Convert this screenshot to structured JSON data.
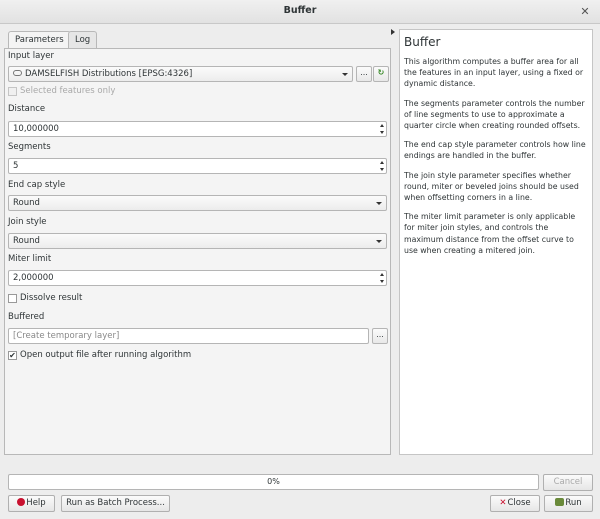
{
  "window": {
    "title": "Buffer",
    "close_glyph": "✕"
  },
  "tabs": [
    {
      "label": "Parameters"
    },
    {
      "label": "Log"
    }
  ],
  "params": {
    "input_layer_label": "Input layer",
    "input_layer_value": "DAMSELFISH Distributions [EPSG:4326]",
    "input_layer_browse": "...",
    "input_layer_icon": "layer-icon",
    "selected_only_label": "Selected features only",
    "distance_label": "Distance",
    "distance_value": "10,000000",
    "segments_label": "Segments",
    "segments_value": "5",
    "end_cap_label": "End cap style",
    "end_cap_value": "Round",
    "join_style_label": "Join style",
    "join_style_value": "Round",
    "miter_label": "Miter limit",
    "miter_value": "2,000000",
    "dissolve_label": "Dissolve result",
    "buffered_label": "Buffered",
    "buffered_placeholder": "[Create temporary layer]",
    "buffered_browse": "...",
    "open_output_label": "Open output file after running algorithm",
    "open_output_checked": "✔"
  },
  "help": {
    "title": "Buffer",
    "paragraphs": [
      "This algorithm computes a buffer area for all the features in an input layer, using a fixed or dynamic distance.",
      "The segments parameter controls the number of line segments to use to approximate a quarter circle when creating rounded offsets.",
      "The end cap style parameter controls how line endings are handled in the buffer.",
      "The join style parameter specifies whether round, miter or beveled joins should be used when offsetting corners in a line.",
      "The miter limit parameter is only applicable for miter join styles, and controls the maximum distance from the offset curve to use when creating a mitered join."
    ]
  },
  "footer": {
    "progress_text": "0%",
    "progress": 0,
    "cancel": "Cancel",
    "help": "Help",
    "batch": "Run as Batch Process...",
    "close": "Close",
    "run": "Run"
  }
}
